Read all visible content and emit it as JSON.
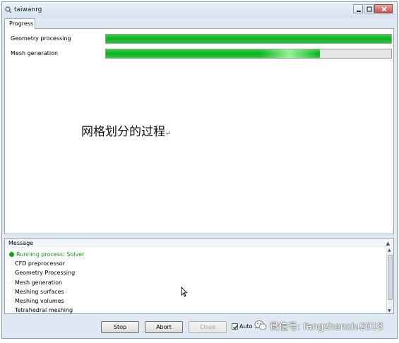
{
  "window": {
    "title": "taiwanrg"
  },
  "tabs": [
    {
      "label": "Progress"
    }
  ],
  "progress": [
    {
      "label": "Geometry processing",
      "value": 1.0
    },
    {
      "label": "Mesh generation",
      "value": 0.75
    }
  ],
  "caption": {
    "text": "网格划分的过程",
    "mark": "↵"
  },
  "message": {
    "header": "Message",
    "status": "Running process: Solver",
    "items": [
      "CFD preprocessor",
      "Geometry Processing",
      "Mesh generation",
      "Meshing surfaces",
      "Meshing volumes",
      "Tetrahedral meshing"
    ]
  },
  "buttons": {
    "stop": "Stop",
    "abort": "Abort",
    "close": "Close"
  },
  "auto_checkbox": {
    "label": "Auto ...",
    "checked": true
  },
  "watermark": {
    "text": "微信号: fangzhenxiu2018"
  },
  "colors": {
    "progress_green": "#0fb11f",
    "status_green": "#149a14"
  },
  "icons": {
    "status": "green-circle-icon",
    "cursor": "arrow-cursor-icon"
  }
}
